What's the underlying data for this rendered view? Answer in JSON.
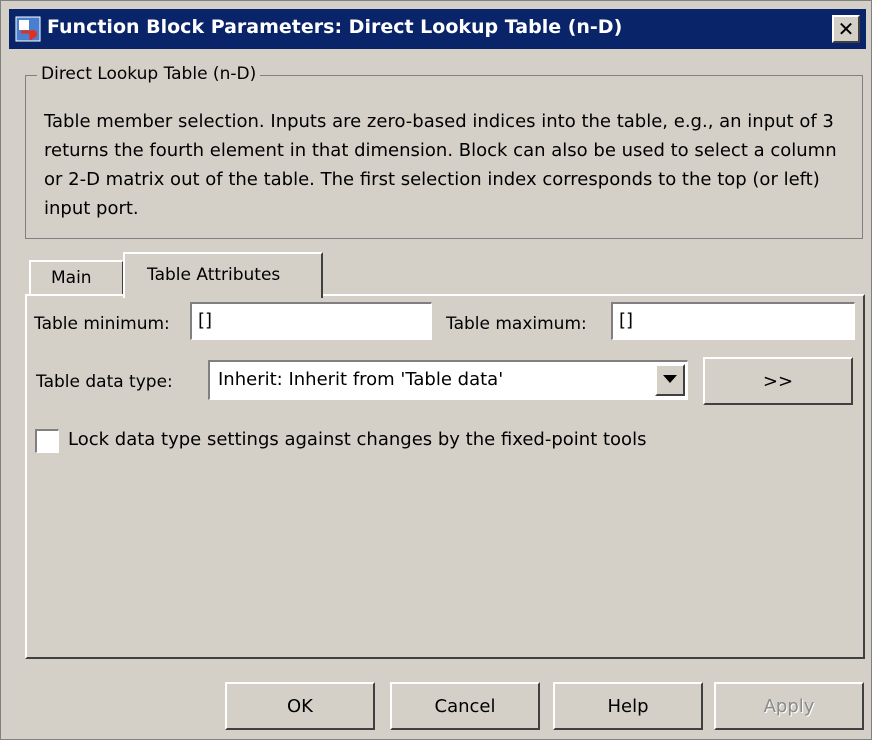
{
  "window": {
    "title": "Function Block Parameters: Direct Lookup Table (n-D)",
    "close_glyph": "✕"
  },
  "group": {
    "legend": "Direct Lookup Table (n-D)",
    "description": "Table member selection.  Inputs are zero-based indices into the table, e.g., an input of 3 returns the fourth element in that dimension. Block can also be used to select a column or 2-D matrix out of the table. The first selection index corresponds to the top (or left) input port."
  },
  "tabs": [
    {
      "label": "Main",
      "selected": false
    },
    {
      "label": "Table Attributes",
      "selected": true
    }
  ],
  "table_attributes": {
    "min_label": "Table minimum:",
    "min_value": "[]",
    "max_label": "Table maximum:",
    "max_value": "[]",
    "datatype_label": "Table data type:",
    "datatype_value": "Inherit: Inherit from 'Table data'",
    "assistant_button": ">>",
    "lock_label": "Lock data type settings against changes by the fixed-point tools",
    "lock_checked": false
  },
  "buttons": {
    "ok": "OK",
    "cancel": "Cancel",
    "help": "Help",
    "apply": "Apply"
  },
  "colors": {
    "titlebar": "#0a246a",
    "dialog_bg": "#d4d0c8"
  }
}
